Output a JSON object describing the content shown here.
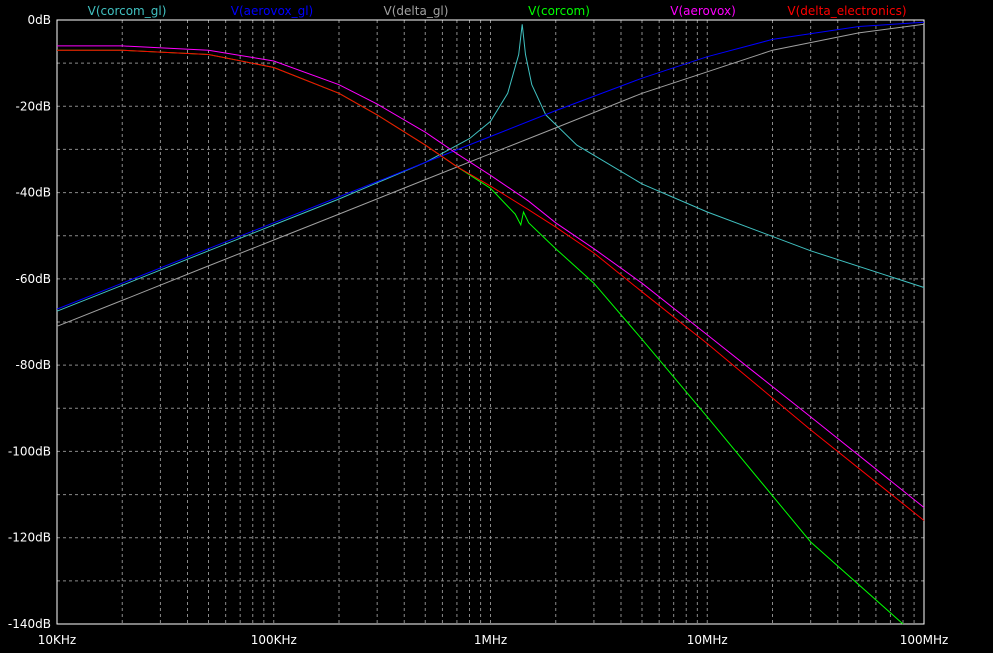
{
  "chart_data": {
    "type": "line",
    "x_scale": "log",
    "y_scale": "linear",
    "xlim": [
      10000,
      100000000
    ],
    "ylim": [
      -140,
      0
    ],
    "grid": true,
    "legend_position": "top",
    "x_tick_values": [
      10000,
      100000,
      1000000,
      10000000,
      100000000
    ],
    "x_tick_labels": [
      "10KHz",
      "100KHz",
      "1MHz",
      "10MHz",
      "100MHz"
    ],
    "y_tick_values": [
      0,
      -20,
      -40,
      -60,
      -80,
      -100,
      -120,
      -140
    ],
    "y_tick_labels": [
      "0dB",
      "-20dB",
      "-40dB",
      "-60dB",
      "-80dB",
      "-100dB",
      "-120dB",
      "-140dB"
    ],
    "series": [
      {
        "name": "V(corcom_gl)",
        "color": "#40c0c0",
        "x": [
          10000,
          20000,
          50000,
          100000,
          200000,
          500000,
          800000,
          1000000,
          1200000,
          1350000,
          1400000,
          1450000,
          1550000,
          1800000,
          2500000,
          5000000,
          10000000,
          30000000,
          100000000
        ],
        "y": [
          -67.5,
          -61.5,
          -53.5,
          -47.5,
          -41.5,
          -33.0,
          -27.5,
          -23.5,
          -17.0,
          -8.0,
          -1.0,
          -8.0,
          -15.0,
          -22.0,
          -29.0,
          -38.0,
          -44.5,
          -53.5,
          -62.0
        ]
      },
      {
        "name": "V(aerovox_gl)",
        "color": "#0000ff",
        "x": [
          10000,
          20000,
          50000,
          100000,
          200000,
          500000,
          1000000,
          2000000,
          5000000,
          10000000,
          20000000,
          50000000,
          100000000
        ],
        "y": [
          -67.0,
          -61.0,
          -53.0,
          -47.0,
          -41.0,
          -33.0,
          -27.0,
          -21.0,
          -13.5,
          -8.5,
          -4.5,
          -1.5,
          -0.5
        ]
      },
      {
        "name": "V(delta_gl)",
        "color": "#a0a0a0",
        "x": [
          10000,
          20000,
          50000,
          100000,
          200000,
          500000,
          1000000,
          2000000,
          5000000,
          10000000,
          20000000,
          50000000,
          100000000
        ],
        "y": [
          -71.0,
          -65.0,
          -57.0,
          -51.0,
          -45.0,
          -37.0,
          -31.0,
          -25.0,
          -17.0,
          -12.0,
          -7.0,
          -3.0,
          -1.0
        ]
      },
      {
        "name": "V(corcom)",
        "color": "#00ff00",
        "x": [
          10000,
          20000,
          50000,
          100000,
          200000,
          300000,
          500000,
          700000,
          1000000,
          1300000,
          1380000,
          1420000,
          1500000,
          2000000,
          3000000,
          5000000,
          10000000,
          30000000,
          80000000
        ],
        "y": [
          -7.0,
          -7.0,
          -8.0,
          -11.0,
          -17.0,
          -22.0,
          -29.0,
          -34.0,
          -39.0,
          -45.0,
          -47.5,
          -44.5,
          -47.0,
          -53.0,
          -61.0,
          -74.0,
          -92.0,
          -121.0,
          -140.0
        ]
      },
      {
        "name": "V(aerovox)",
        "color": "#ff00ff",
        "x": [
          10000,
          20000,
          50000,
          100000,
          200000,
          300000,
          500000,
          700000,
          1000000,
          1500000,
          2000000,
          3000000,
          5000000,
          10000000,
          30000000,
          100000000
        ],
        "y": [
          -6.0,
          -6.0,
          -7.0,
          -9.5,
          -15.0,
          -19.5,
          -26.0,
          -31.0,
          -36.0,
          -42.0,
          -47.0,
          -53.0,
          -61.0,
          -73.0,
          -92.0,
          -113.0
        ]
      },
      {
        "name": "V(delta_electronics)",
        "color": "#ff0000",
        "x": [
          10000,
          20000,
          50000,
          100000,
          200000,
          300000,
          500000,
          700000,
          1000000,
          1500000,
          2000000,
          3000000,
          5000000,
          10000000,
          30000000,
          100000000
        ],
        "y": [
          -7.0,
          -7.0,
          -8.0,
          -11.0,
          -17.0,
          -22.0,
          -29.0,
          -34.0,
          -38.5,
          -44.0,
          -48.0,
          -54.0,
          -63.0,
          -75.0,
          -95.0,
          -116.0
        ]
      }
    ]
  }
}
